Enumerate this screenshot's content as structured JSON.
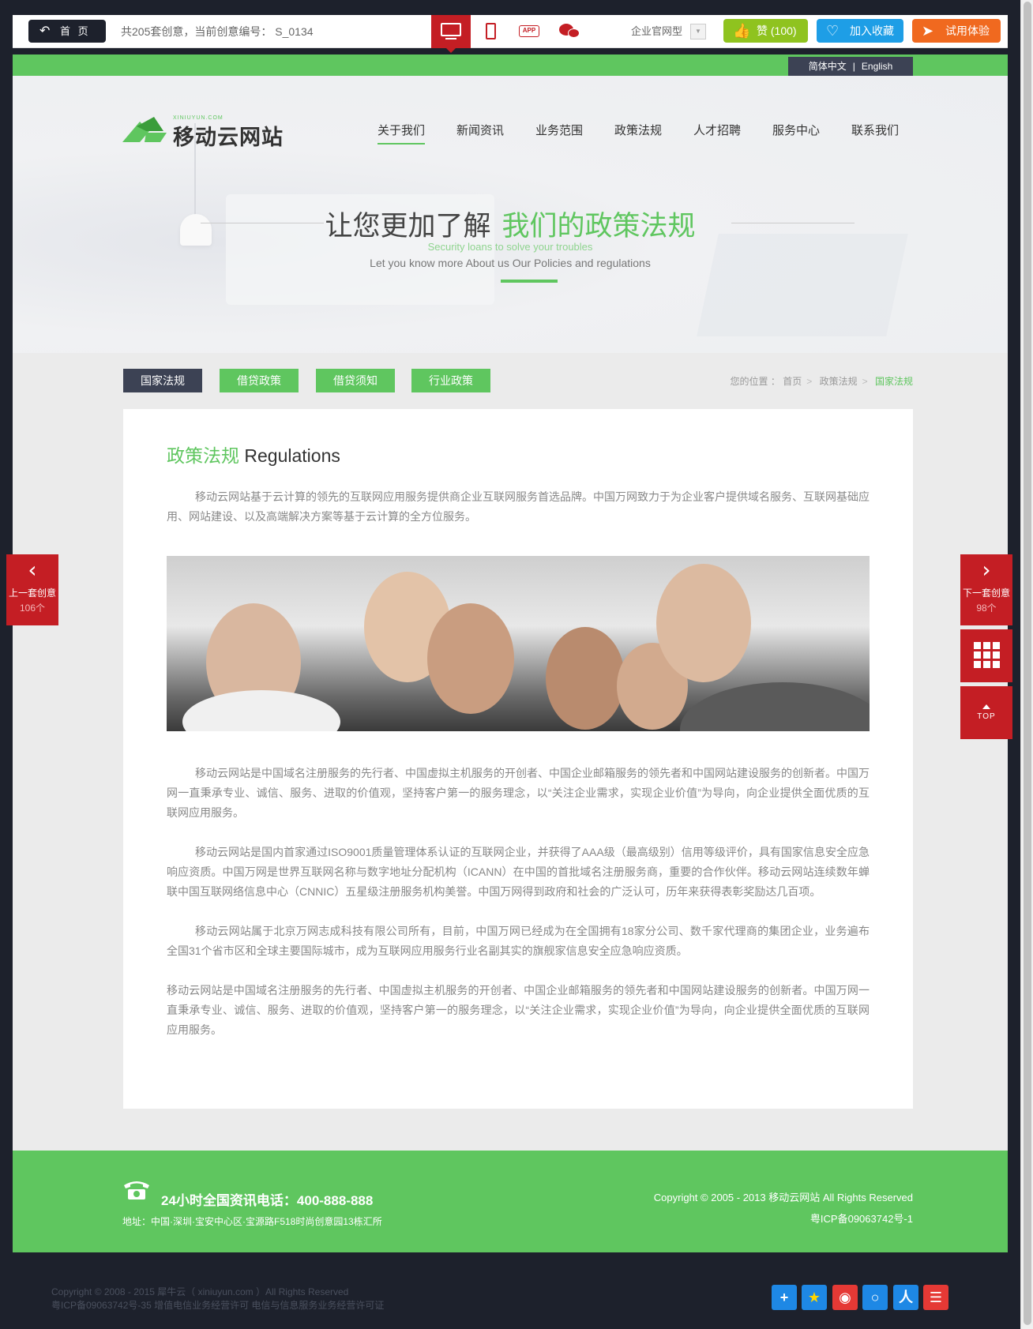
{
  "toolbar": {
    "home_label": "首 页",
    "demo_info": "共205套创意，当前创意编号： S_0134",
    "site_type": "企业官网型",
    "like_label": "赞 (100)",
    "fav_label": "加入收藏",
    "trial_label": "试用体验",
    "app_icon_text": "APP"
  },
  "lang": {
    "cn": "简体中文",
    "en": "English"
  },
  "logo": {
    "url": "XINIUYUN.COM",
    "name": "移动云网站"
  },
  "nav": [
    "关于我们",
    "新闻资讯",
    "业务范围",
    "政策法规",
    "人才招聘",
    "服务中心",
    "联系我们"
  ],
  "hero": {
    "title_part1": "让您更加了解",
    "title_part2": "我们的政策法规",
    "sub1": "Security loans to solve your troubles",
    "sub2": "Let you know more About us Our Policies and regulations"
  },
  "subtabs": [
    "国家法规",
    "借贷政策",
    "借贷须知",
    "行业政策"
  ],
  "breadcrumb": {
    "label": "您的位置 ：",
    "home": "首页",
    "parent": "政策法规",
    "current": "国家法规"
  },
  "content": {
    "title_cn": "政策法规",
    "title_en": "Regulations",
    "intro": "移动云网站基于云计算的领先的互联网应用服务提供商企业互联网服务首选品牌。中国万网致力于为企业客户提供域名服务、互联网基础应用、网站建设、以及高端解决方案等基于云计算的全方位服务。",
    "p1": "移动云网站是中国域名注册服务的先行者、中国虚拟主机服务的开创者、中国企业邮箱服务的领先者和中国网站建设服务的创新者。中国万网一直秉承专业、诚信、服务、进取的价值观，坚持客户第一的服务理念，以“关注企业需求，实现企业价值”为导向，向企业提供全面优质的互联网应用服务。",
    "p2": "移动云网站是国内首家通过ISO9001质量管理体系认证的互联网企业，并获得了AAA级（最高级别）信用等级评价，具有国家信息安全应急响应资质。中国万网是世界互联网名称与数字地址分配机构（ICANN）在中国的首批域名注册服务商，重要的合作伙伴。移动云网站连续数年蝉联中国互联网络信息中心（CNNIC）五星级注册服务机构美誉。中国万网得到政府和社会的广泛认可，历年来获得表彰奖励达几百项。",
    "p3": "移动云网站属于北京万网志成科技有限公司所有，目前，中国万网已经成为在全国拥有18家分公司、数千家代理商的集团企业，业务遍布全国31个省市区和全球主要国际城市，成为互联网应用服务行业名副其实的旗舰家信息安全应急响应资质。",
    "p4": "移动云网站是中国域名注册服务的先行者、中国虚拟主机服务的开创者、中国企业邮箱服务的领先者和中国网站建设服务的创新者。中国万网一直秉承专业、诚信、服务、进取的价值观，坚持客户第一的服务理念，以“关注企业需求，实现企业价值”为导向，向企业提供全面优质的互联网应用服务。"
  },
  "footer": {
    "phone": "24小时全国资讯电话：400-888-888",
    "address": "地址：中国·深圳·宝安中心区·宝源路F518时尚创意园13栋汇所",
    "copyright": "Copyright © 2005 - 2013 移动云网站  All Rights Reserved",
    "icp": "粤ICP备09063742号-1"
  },
  "side": {
    "prev_label": "上一套创意",
    "prev_count": "106个",
    "next_label": "下一套创意",
    "next_count": "98个",
    "top_label": "TOP"
  },
  "bottom": {
    "line1": "Copyright © 2008 - 2015 犀牛云（ xiniuyun.com ）All Rights Reserved",
    "line2": "粤ICP备09063742号-35 增值电信业务经营许可 电信与信息服务业务经营许可证"
  },
  "colors": {
    "green": "#5fc65f",
    "red": "#c41e24",
    "dark": "#1d212c",
    "navy": "#3c4254"
  }
}
